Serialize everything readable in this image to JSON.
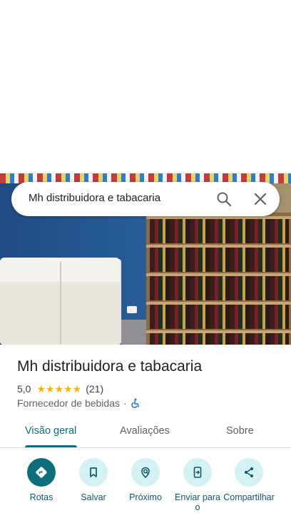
{
  "search": {
    "query": "Mh distribuidora e tabacaria"
  },
  "place": {
    "name": "Mh distribuidora e tabacaria",
    "rating": "5,0",
    "stars": "★★★★★",
    "reviews": "(21)",
    "category": "Fornecedor de bebidas",
    "separator": "·"
  },
  "tabs": [
    {
      "label": "Visão geral",
      "active": true
    },
    {
      "label": "Avaliações",
      "active": false
    },
    {
      "label": "Sobre",
      "active": false
    }
  ],
  "actions": [
    {
      "label": "Rotas",
      "icon": "directions-icon"
    },
    {
      "label": "Salvar",
      "icon": "bookmark-icon"
    },
    {
      "label": "Próximo",
      "icon": "nearby-icon"
    },
    {
      "label": "Enviar para o",
      "icon": "send-to-phone-icon"
    },
    {
      "label": "Compartilhar",
      "icon": "share-icon"
    }
  ],
  "colors": {
    "accent": "#0b6e7a",
    "action_bg": "#d4f1f4",
    "star": "#f5b400"
  }
}
